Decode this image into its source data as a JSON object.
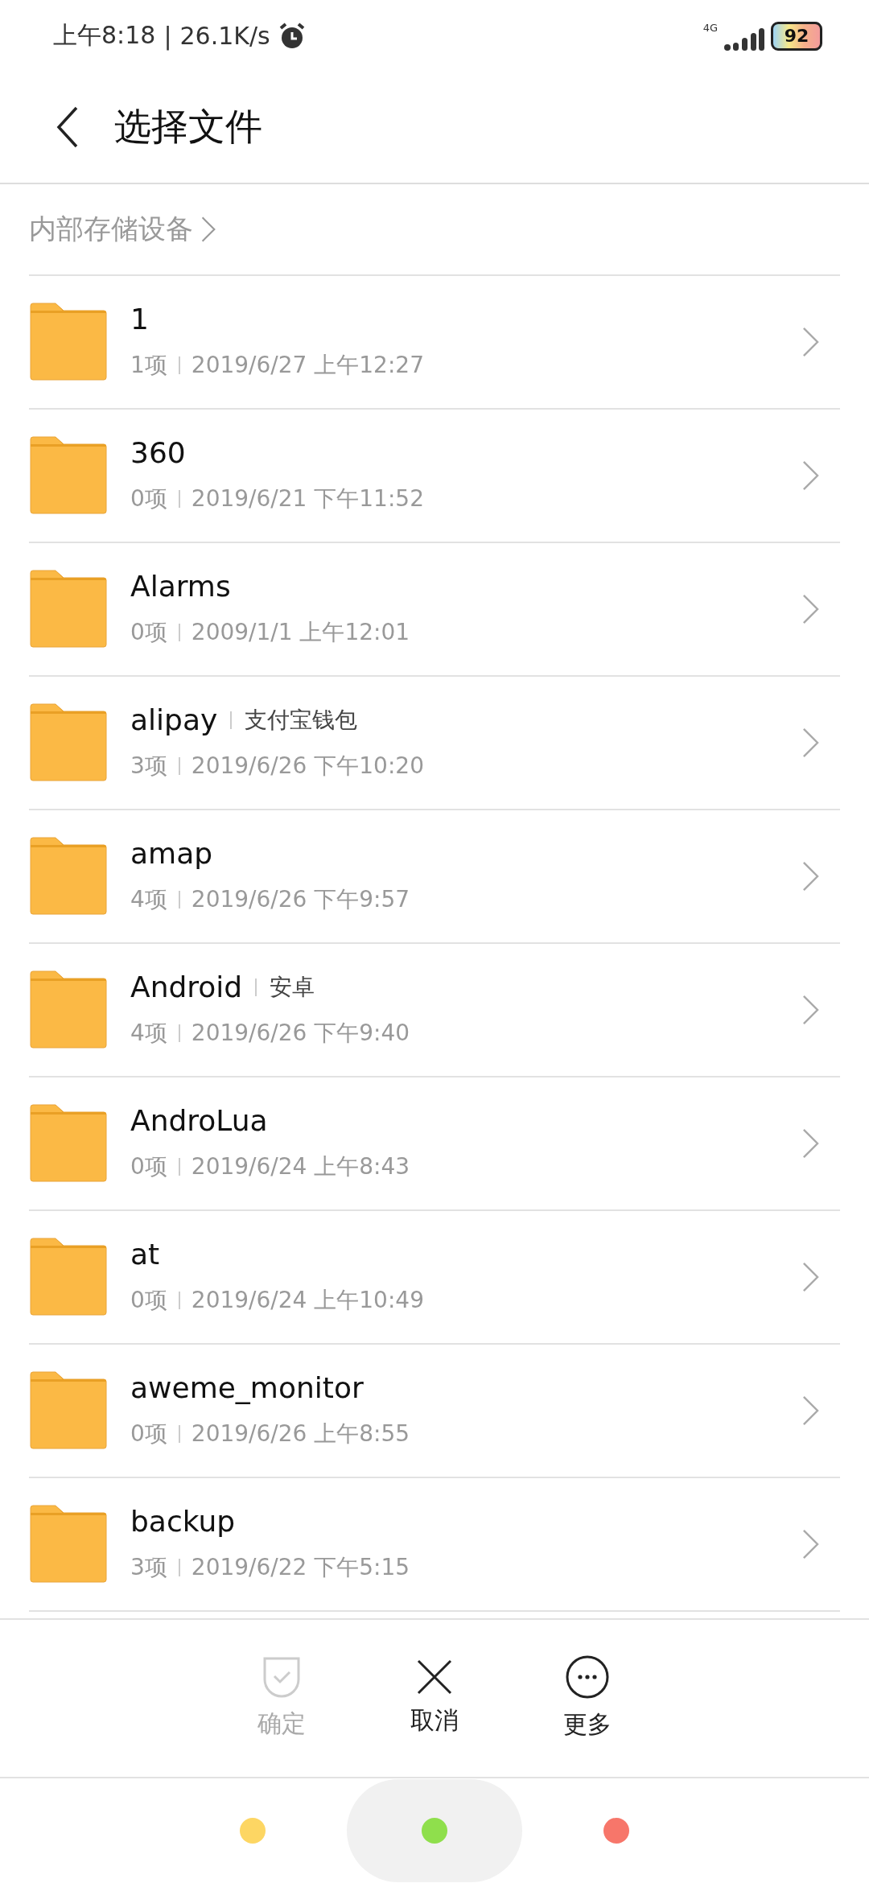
{
  "status_bar": {
    "time": "上午8:18",
    "separator": "|",
    "speed": "26.1K/s",
    "network": "4G",
    "battery": "92"
  },
  "header": {
    "title": "选择文件"
  },
  "breadcrumb": {
    "label": "内部存储设备"
  },
  "files": [
    {
      "name": "1",
      "count": "1项",
      "date": "2019/6/27 上午12:27"
    },
    {
      "name": "360",
      "count": "0项",
      "date": "2019/6/21 下午11:52"
    },
    {
      "name": "Alarms",
      "count": "0项",
      "date": "2009/1/1 上午12:01"
    },
    {
      "name": "alipay",
      "tag": "支付宝钱包",
      "count": "3项",
      "date": "2019/6/26 下午10:20"
    },
    {
      "name": "amap",
      "count": "4项",
      "date": "2019/6/26 下午9:57"
    },
    {
      "name": "Android",
      "tag": "安卓",
      "count": "4项",
      "date": "2019/6/26 下午9:40"
    },
    {
      "name": "AndroLua",
      "count": "0项",
      "date": "2019/6/24 上午8:43"
    },
    {
      "name": "at",
      "count": "0项",
      "date": "2019/6/24 上午10:49"
    },
    {
      "name": "aweme_monitor",
      "count": "0项",
      "date": "2019/6/26 上午8:55"
    },
    {
      "name": "backup",
      "count": "3项",
      "date": "2019/6/22 下午5:15"
    }
  ],
  "actions": [
    {
      "kind": "confirm",
      "label": "确定",
      "disabled": true
    },
    {
      "kind": "cancel",
      "label": "取消",
      "disabled": false
    },
    {
      "kind": "more",
      "label": "更多",
      "disabled": false
    }
  ],
  "nav_buttons": [
    {
      "color": "#fdd663",
      "selected": false
    },
    {
      "color": "#8fdf4c",
      "selected": true
    },
    {
      "color": "#f7766a",
      "selected": false
    }
  ]
}
